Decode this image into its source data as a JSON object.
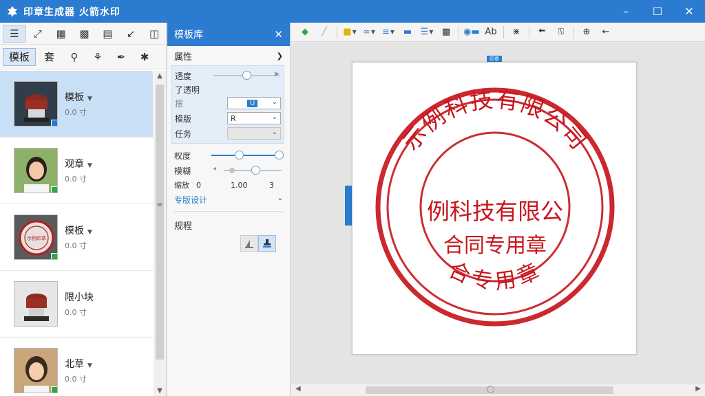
{
  "app": {
    "title": "印章生成器 火箭水印",
    "window_controls": [
      "minimize",
      "maximize",
      "close"
    ]
  },
  "left_toolbar": {
    "tabs": [
      {
        "label": "模板",
        "active": true
      },
      {
        "label": "套",
        "active": false
      }
    ]
  },
  "template_list": [
    {
      "name": "模板",
      "sub": "0.0 寸",
      "selected": true,
      "badge_color": "#1e7bd6",
      "thumb": "stamp-device"
    },
    {
      "name": "观章",
      "sub": "0.0 寸",
      "selected": false,
      "badge_color": "#2aa84a",
      "thumb": "portrait-woman"
    },
    {
      "name": "模板",
      "sub": "0.0 寸",
      "selected": false,
      "badge_color": "#2aa84a",
      "thumb": "red-seal",
      "thumb_text": "示例印章"
    },
    {
      "name": "限小块",
      "sub": "0.0 寸",
      "selected": false,
      "badge_color": "",
      "thumb": "stamp-device"
    },
    {
      "name": "北草",
      "sub": "0.0 寸",
      "selected": false,
      "badge_color": "#2aa84a",
      "thumb": "portrait-woman"
    }
  ],
  "mid_panel": {
    "title": "模板库",
    "section_props": "属性",
    "rows": {
      "opacity_label": "透度",
      "opacity_sub": "了透明",
      "size_label": "摆",
      "size_value": "U",
      "level_label": "模版",
      "level_value": "R",
      "task_label": "任务",
      "density_label": "权度",
      "blur_label": "模糊",
      "scale_label": "缩放",
      "scale_min": "0",
      "scale_mid": "1.00",
      "scale_max": "3",
      "more_link": "专版设计"
    },
    "section_rules": "规程",
    "values": {
      "opacity": 0.5,
      "density": 0.9,
      "blur": 0.55
    }
  },
  "stamp": {
    "outer_text": "示例科技有限公司",
    "center_line1": "例科技有限公",
    "center_line2": "合同专用章",
    "bottom_text": "合专用章",
    "color": "#c8161d"
  },
  "canvas": {
    "top_ruler_label": "印章"
  },
  "colors": {
    "titlebar": "#2b7bd0",
    "selected_row": "#c9dff6",
    "accent": "#2b7bd0"
  }
}
